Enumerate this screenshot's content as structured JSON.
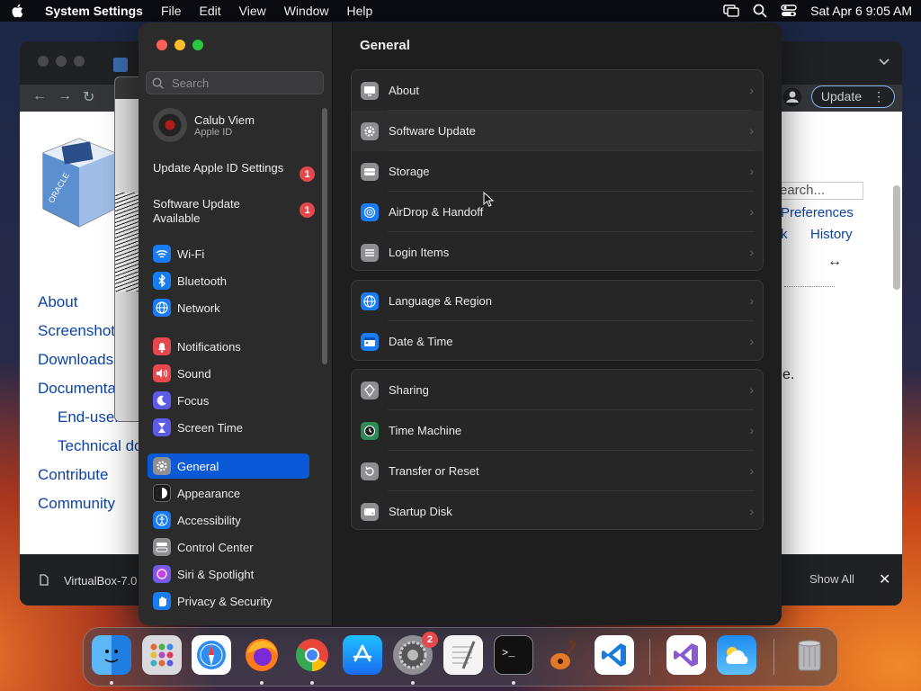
{
  "menubar": {
    "app": "System Settings",
    "menus": [
      "File",
      "Edit",
      "View",
      "Window",
      "Help"
    ],
    "clock": "Sat Apr 6  9:05 AM"
  },
  "browser": {
    "update_label": "Update",
    "search_placeholder": "earch...",
    "links": [
      "About",
      "Screenshots",
      "Downloads",
      "Documentation",
      "End-user docs",
      "Technical docs",
      "Contribute",
      "Community"
    ],
    "right_links": {
      "prefs": "Preferences",
      "k": "k",
      "history": "History"
    },
    "arrow_text": "↔",
    "trailing_text": "e.",
    "download_name": "VirtualBox-7.0",
    "show_all": "Show All",
    "close": "✕"
  },
  "settings": {
    "search_placeholder": "Search",
    "account": {
      "name": "Calub Viem",
      "sub": "Apple ID"
    },
    "alerts": [
      {
        "label": "Update Apple ID Settings",
        "badge": "1"
      },
      {
        "label": "Software Update Available",
        "badge": "1"
      }
    ],
    "sidebar": [
      {
        "label": "Wi-Fi",
        "icon": "wifi-icon",
        "color": "#1a7cf5"
      },
      {
        "label": "Bluetooth",
        "icon": "bluetooth-icon",
        "color": "#1a7cf5"
      },
      {
        "label": "Network",
        "icon": "globe-icon",
        "color": "#1a7cf5"
      },
      {
        "label": "Notifications",
        "icon": "bell-icon",
        "color": "#e5484d"
      },
      {
        "label": "Sound",
        "icon": "speaker-icon",
        "color": "#e5484d"
      },
      {
        "label": "Focus",
        "icon": "moon-icon",
        "color": "#5e5ce6"
      },
      {
        "label": "Screen Time",
        "icon": "hourglass-icon",
        "color": "#5e5ce6"
      },
      {
        "label": "General",
        "icon": "gear-icon",
        "color": "#8e8e93"
      },
      {
        "label": "Appearance",
        "icon": "appearance-icon",
        "color": "#1c1c1e"
      },
      {
        "label": "Accessibility",
        "icon": "accessibility-icon",
        "color": "#1a7cf5"
      },
      {
        "label": "Control Center",
        "icon": "control-center-icon",
        "color": "#8e8e93"
      },
      {
        "label": "Siri & Spotlight",
        "icon": "siri-icon",
        "color": "#c23ecf"
      },
      {
        "label": "Privacy & Security",
        "icon": "hand-icon",
        "color": "#1a7cf5"
      }
    ],
    "main": {
      "title": "General",
      "groups": [
        [
          {
            "label": "About",
            "icon": "display-icon",
            "color": "#8e8e93"
          },
          {
            "label": "Software Update",
            "icon": "gear-badge-icon",
            "color": "#8e8e93"
          },
          {
            "label": "Storage",
            "icon": "drive-icon",
            "color": "#8e8e93"
          },
          {
            "label": "AirDrop & Handoff",
            "icon": "airdrop-icon",
            "color": "#1a7cf5"
          },
          {
            "label": "Login Items",
            "icon": "list-icon",
            "color": "#8e8e93"
          }
        ],
        [
          {
            "label": "Language & Region",
            "icon": "globe-icon",
            "color": "#1a7cf5"
          },
          {
            "label": "Date & Time",
            "icon": "calendar-icon",
            "color": "#1a7cf5"
          }
        ],
        [
          {
            "label": "Sharing",
            "icon": "sharing-icon",
            "color": "#8e8e93"
          },
          {
            "label": "Time Machine",
            "icon": "time-machine-icon",
            "color": "#2e8b57"
          },
          {
            "label": "Transfer or Reset",
            "icon": "reset-icon",
            "color": "#8e8e93"
          },
          {
            "label": "Startup Disk",
            "icon": "disk-icon",
            "color": "#8e8e93"
          }
        ]
      ]
    }
  },
  "dock": {
    "apps": [
      "finder-icon",
      "launchpad-icon",
      "safari-icon",
      "firefox-icon",
      "chrome-icon",
      "app-store-icon",
      "system-settings-icon",
      "textedit-icon",
      "terminal-icon",
      "garageband-icon",
      "vscode-icon",
      "visual-studio-icon",
      "weather-icon",
      "trash-icon"
    ],
    "settings_badge": "2"
  }
}
